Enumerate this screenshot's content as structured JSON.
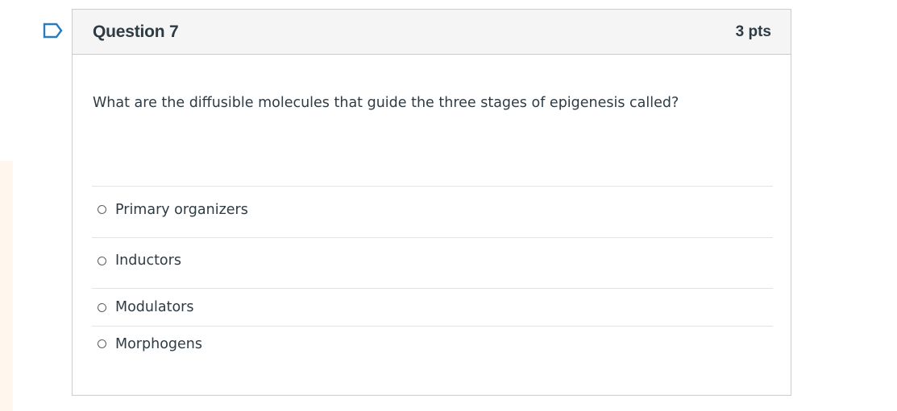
{
  "question": {
    "title": "Question 7",
    "points": "3 pts",
    "text": "What are the diffusible molecules that guide the three stages of epigenesis called?",
    "flag_icon": "bookmark-flag-icon"
  },
  "answers": [
    {
      "label": "Primary organizers",
      "selected": false
    },
    {
      "label": "Inductors",
      "selected": false
    },
    {
      "label": "Modulators",
      "selected": false
    },
    {
      "label": "Morphogens",
      "selected": false
    }
  ],
  "colors": {
    "accent": "#2b7abc",
    "text": "#2d3b45",
    "header_bg": "#f5f5f5",
    "border": "#c7cdd1"
  }
}
